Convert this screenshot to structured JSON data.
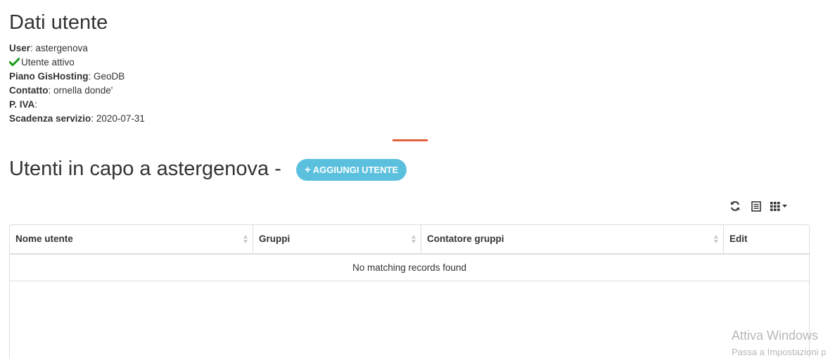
{
  "user_section": {
    "title": "Dati utente",
    "user_label": "User",
    "user_value": ": astergenova",
    "active_text": "Utente attivo",
    "plan_label": "Piano GisHosting",
    "plan_value": ": GeoDB",
    "contact_label": "Contatto",
    "contact_value": ": ornella donde'",
    "vat_label": "P. IVA",
    "vat_value": ":",
    "expiry_label": "Scadenza servizio",
    "expiry_value": ": 2020-07-31"
  },
  "users_section": {
    "title": "Utenti in capo a astergenova -",
    "add_button_label": "AGGIUNGI UTENTE"
  },
  "toolbar": {
    "refresh_icon": "refresh-icon",
    "toggle_view_icon": "list-icon",
    "columns_icon": "columns-grid-icon"
  },
  "table": {
    "columns": [
      "Nome utente",
      "Gruppi",
      "Contatore gruppi",
      "Edit"
    ],
    "empty_message": "No matching records found"
  },
  "watermark": {
    "line1": "Attiva Windows",
    "line2": "Passa a Impostazioni p"
  },
  "colors": {
    "accent_button": "#5bc0de",
    "divider": "#e4623a",
    "check": "#1a9a1a"
  }
}
